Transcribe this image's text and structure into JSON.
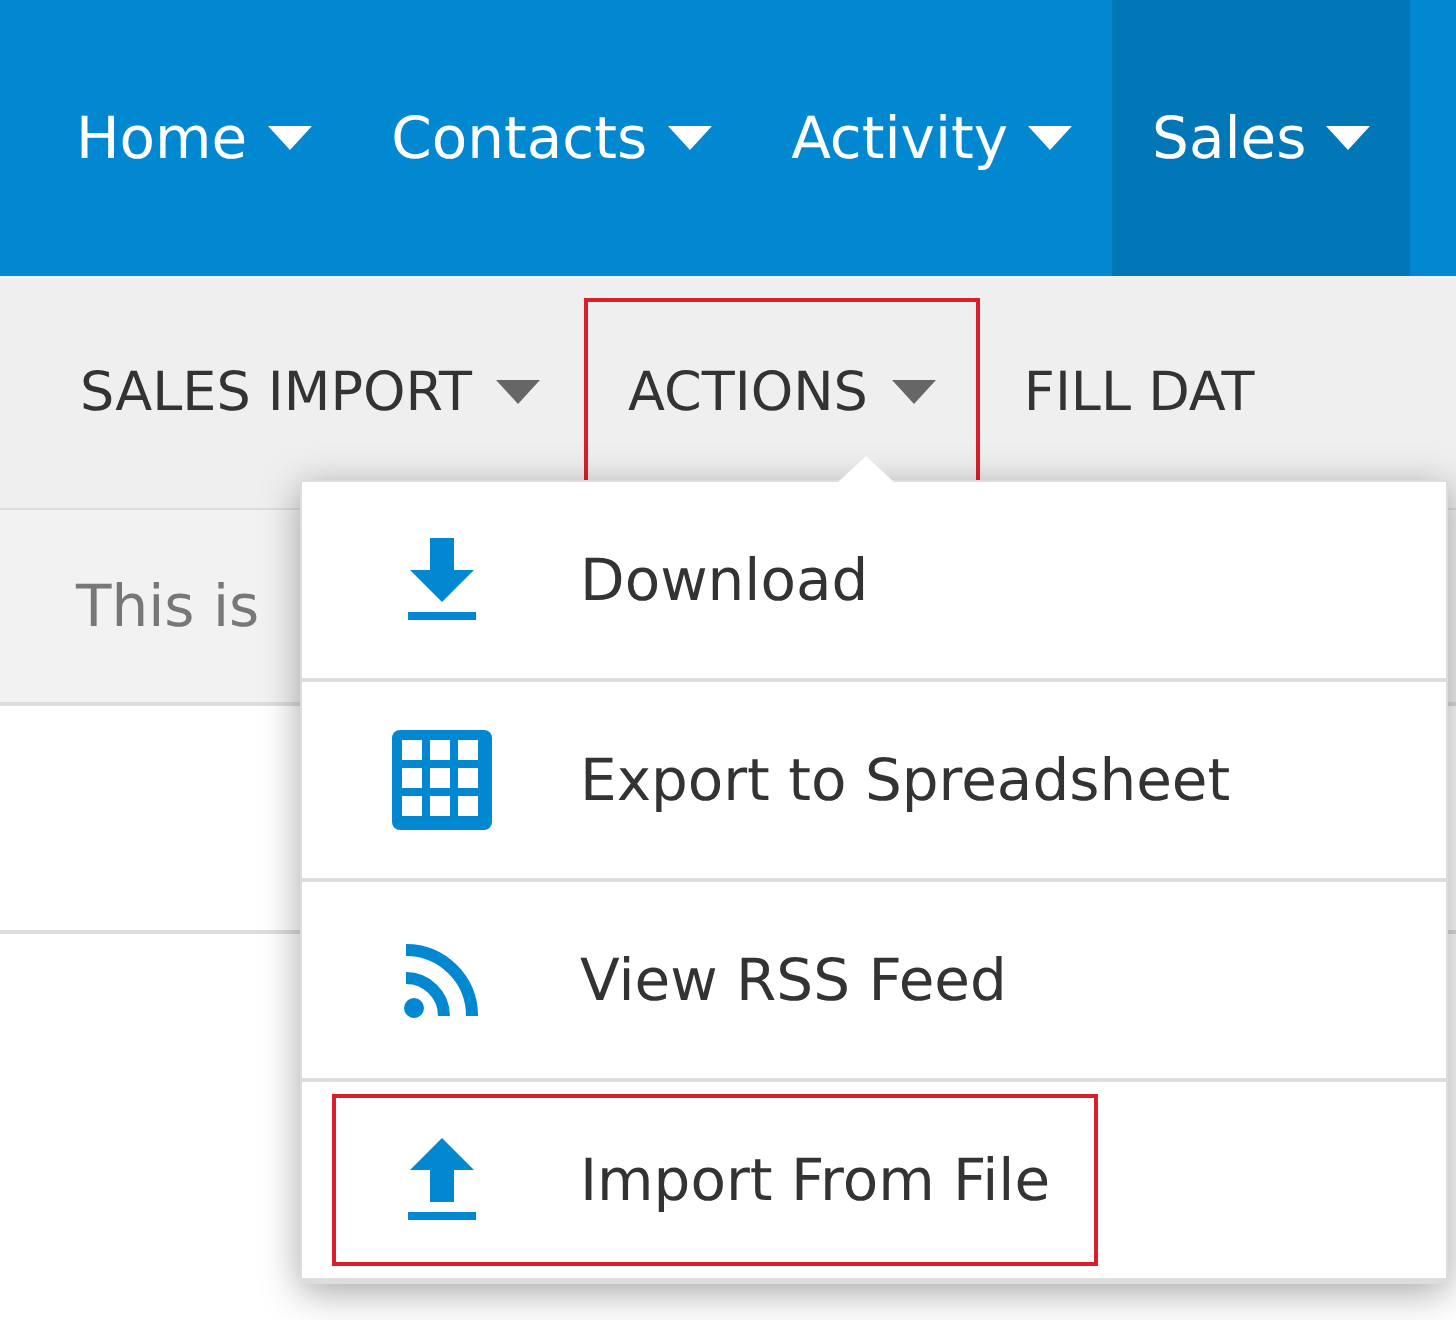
{
  "top_nav": [
    {
      "label": "Home",
      "selected": false
    },
    {
      "label": "Contacts",
      "selected": false
    },
    {
      "label": "Activity",
      "selected": false
    },
    {
      "label": "Sales",
      "selected": true
    }
  ],
  "sub_nav": [
    {
      "label": "SALES IMPORT",
      "highlighted": false,
      "has_caret": true
    },
    {
      "label": "ACTIONS",
      "highlighted": true,
      "has_caret": true
    },
    {
      "label": "FILL DAT",
      "highlighted": false,
      "has_caret": false
    }
  ],
  "notice": "This is",
  "actions_menu": [
    {
      "kind": "download",
      "label": "Download",
      "highlighted": false
    },
    {
      "kind": "grid",
      "label": "Export to Spreadsheet",
      "highlighted": false
    },
    {
      "kind": "rss",
      "label": "View RSS Feed",
      "highlighted": false
    },
    {
      "kind": "upload",
      "label": "Import From File",
      "highlighted": true
    }
  ]
}
